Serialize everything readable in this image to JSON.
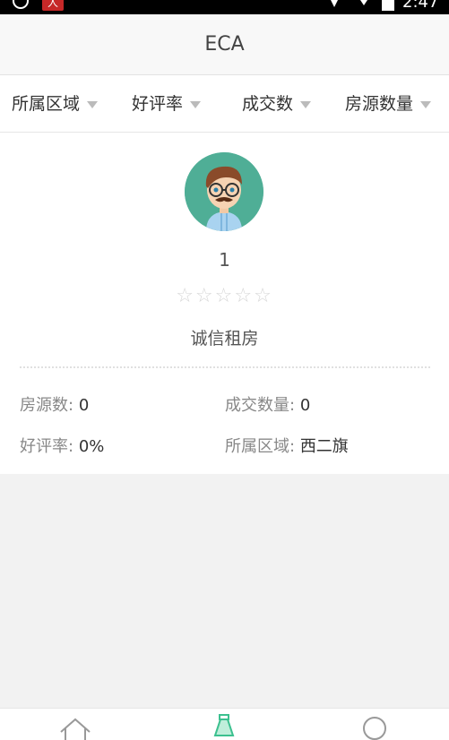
{
  "status_bar": {
    "notification_badge": "人",
    "time": "2:47"
  },
  "header": {
    "title": "ECA"
  },
  "filters": [
    {
      "label": "所属区域"
    },
    {
      "label": "好评率"
    },
    {
      "label": "成交数"
    },
    {
      "label": "房源数量"
    }
  ],
  "agent": {
    "name": "1",
    "rating": 0,
    "rating_max": 5,
    "stars_text": "☆☆☆☆☆",
    "tagline": "诚信租房",
    "stats": {
      "listings_label": "房源数:",
      "listings_value": "0",
      "deals_label": "成交数量:",
      "deals_value": "0",
      "rating_label": "好评率:",
      "rating_value": "0%",
      "area_label": "所属区域:",
      "area_value": "西二旗"
    }
  },
  "tabbar": {
    "icons": [
      "home-icon",
      "bottle-icon",
      "profile-icon"
    ]
  },
  "colors": {
    "avatar_bg": "#4fae96",
    "accent_green": "#3cc08f"
  }
}
